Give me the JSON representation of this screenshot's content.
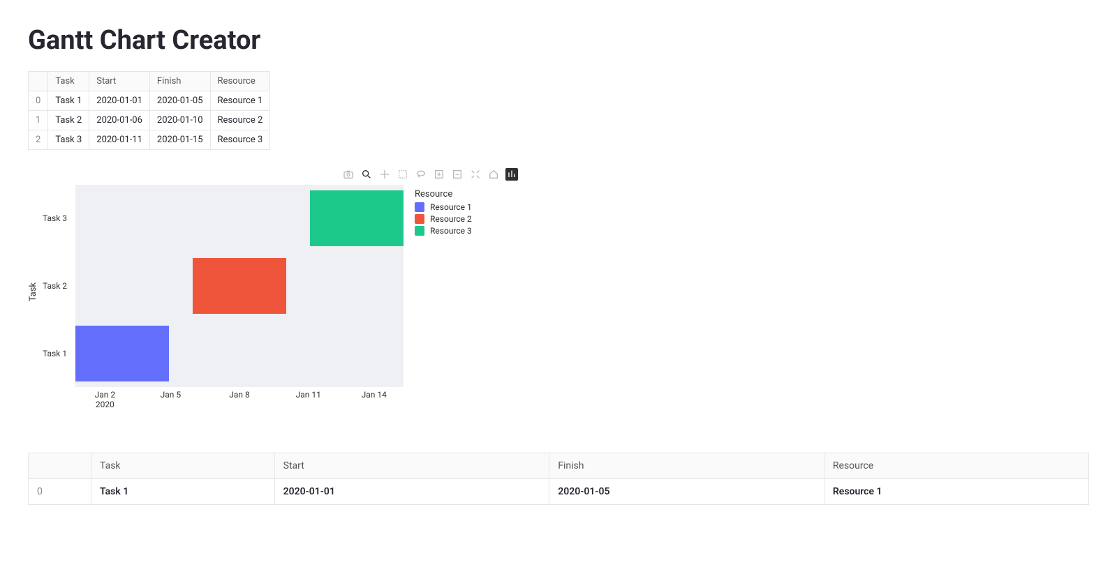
{
  "title": "Gantt Chart Creator",
  "columns": {
    "index": "",
    "task": "Task",
    "start": "Start",
    "finish": "Finish",
    "resource": "Resource"
  },
  "rows": [
    {
      "idx": "0",
      "task": "Task 1",
      "start": "2020-01-01",
      "finish": "2020-01-05",
      "resource": "Resource 1"
    },
    {
      "idx": "1",
      "task": "Task 2",
      "start": "2020-01-06",
      "finish": "2020-01-10",
      "resource": "Resource 2"
    },
    {
      "idx": "2",
      "task": "Task 3",
      "start": "2020-01-11",
      "finish": "2020-01-15",
      "resource": "Resource 3"
    }
  ],
  "legend_title": "Resource",
  "legend": [
    {
      "name": "Resource 1",
      "color": "#636efa"
    },
    {
      "name": "Resource 2",
      "color": "#ef553b"
    },
    {
      "name": "Resource 3",
      "color": "#1cc88a"
    }
  ],
  "yaxis_title": "Task",
  "xticks": [
    {
      "label": "Jan 2",
      "sub": "2020",
      "pos": 9
    },
    {
      "label": "Jan 5",
      "pos": 29
    },
    {
      "label": "Jan 8",
      "pos": 50
    },
    {
      "label": "Jan 11",
      "pos": 71
    },
    {
      "label": "Jan 14",
      "pos": 91
    }
  ],
  "chart_data": {
    "type": "bar",
    "orientation": "horizontal-gantt",
    "ylabel": "Task",
    "legend_title": "Resource",
    "x_range": [
      "2020-01-01",
      "2020-01-15"
    ],
    "categories": [
      "Task 1",
      "Task 2",
      "Task 3"
    ],
    "series": [
      {
        "name": "Resource 1",
        "color": "#636efa",
        "task": "Task 1",
        "start": "2020-01-01",
        "finish": "2020-01-05"
      },
      {
        "name": "Resource 2",
        "color": "#ef553b",
        "task": "Task 2",
        "start": "2020-01-06",
        "finish": "2020-01-10"
      },
      {
        "name": "Resource 3",
        "color": "#1cc88a",
        "task": "Task 3",
        "start": "2020-01-11",
        "finish": "2020-01-15"
      }
    ],
    "xticks": [
      "Jan 2",
      "Jan 5",
      "Jan 8",
      "Jan 11",
      "Jan 14"
    ],
    "xtick_year": "2020"
  },
  "wide_table_visible_rows": [
    {
      "idx": "0",
      "task": "Task 1",
      "start": "2020-01-01",
      "finish": "2020-01-05",
      "resource": "Resource 1"
    }
  ]
}
